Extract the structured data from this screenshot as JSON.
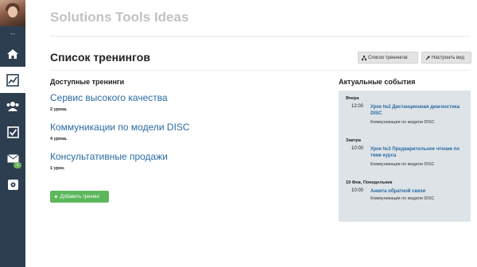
{
  "app": {
    "title": "Solutions Tools Ideas"
  },
  "sidebar": {
    "items": [
      {
        "icon": "home-icon"
      },
      {
        "icon": "chart-icon",
        "active": true
      },
      {
        "icon": "users-icon"
      },
      {
        "icon": "checkbox-icon"
      },
      {
        "icon": "mail-icon",
        "badge": "1"
      },
      {
        "icon": "settings-icon"
      }
    ]
  },
  "page": {
    "title": "Список тренингов",
    "buttons": {
      "list": "Список тренингов",
      "view": "Настроить вид"
    }
  },
  "available": {
    "heading": "Доступные тренинги",
    "trainings": [
      {
        "title": "Сервис высокого качества",
        "lessons": "2 урока."
      },
      {
        "title": "Коммуникации по модели DISC",
        "lessons": "4 урока."
      },
      {
        "title": "Консультативные продажи",
        "lessons": "1 урок."
      }
    ],
    "add_button": "Добавить тренинг"
  },
  "events": {
    "heading": "Актуальные события",
    "groups": [
      {
        "day": "Вчера",
        "time": "12:00",
        "title": "Урок №2 Дистанционная диагностика DISC",
        "course": "Коммуникации по модели DISC"
      },
      {
        "day": "Завтра",
        "time": "10:00",
        "title": "Урок №3 Предварительное чтение по теме курса",
        "course": "Коммуникации по модели DISC"
      },
      {
        "day": "19 Фев, Понедельник",
        "time": "10:00",
        "title": "Анкета обратной связи",
        "course": "Коммуникации по модели DISC"
      }
    ]
  },
  "colors": {
    "sidebar": "#2d3e50",
    "link": "#2b6aa3",
    "add_button": "#5cb85c",
    "events_bg": "#dde3e7"
  }
}
